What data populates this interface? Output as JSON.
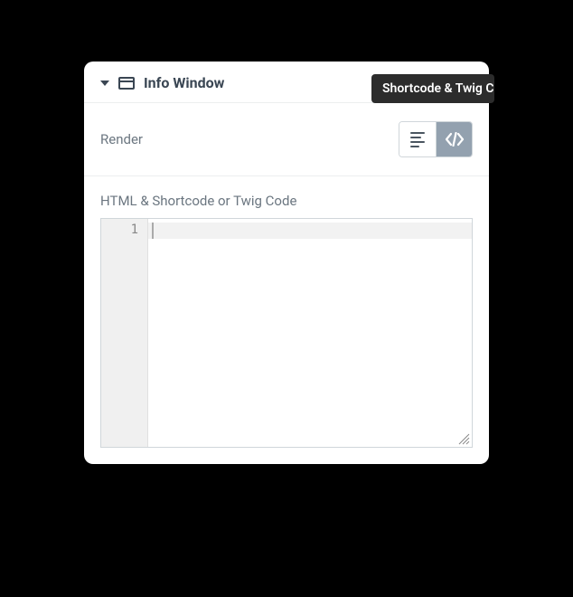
{
  "header": {
    "title": "Info Window"
  },
  "render": {
    "label": "Render",
    "tooltip": "Shortcode & Twig C",
    "buttons": {
      "text_mode": "text",
      "code_mode": "code"
    }
  },
  "code_section": {
    "label": "HTML & Shortcode or Twig Code",
    "line_number": "1",
    "content": ""
  }
}
